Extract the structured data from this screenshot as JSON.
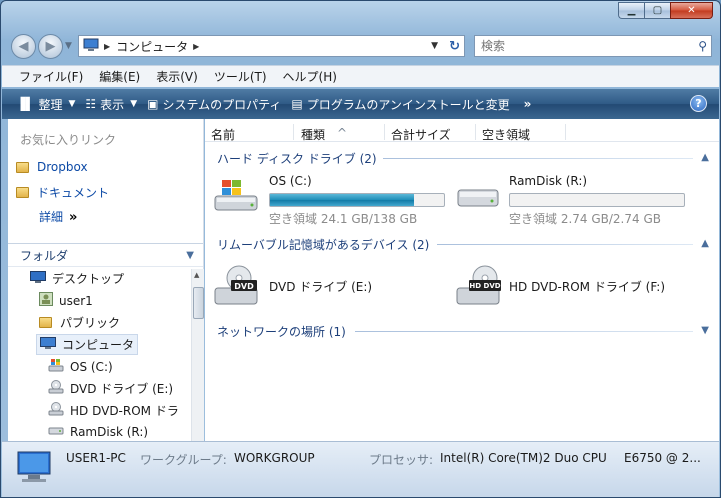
{
  "address": {
    "location": "コンピュータ"
  },
  "search": {
    "placeholder": "検索"
  },
  "menu": [
    "ファイル(F)",
    "編集(E)",
    "表示(V)",
    "ツール(T)",
    "ヘルプ(H)"
  ],
  "command_bar": {
    "organize": "整理",
    "view": "表示",
    "system_properties": "システムのプロパティ",
    "uninstall": "プログラムのアンインストールと変更",
    "more": "»"
  },
  "favorites": {
    "title": "お気に入りリンク",
    "links": [
      "Dropbox",
      "ドキュメント"
    ],
    "details": "詳細",
    "details_arrow": "»"
  },
  "folders": {
    "title": "フォルダ",
    "tree": [
      "デスクトップ",
      "user1",
      "パブリック",
      "コンピュータ",
      "OS (C:)",
      "DVD ドライブ (E:)",
      "HD DVD-ROM ドラ",
      "RamDisk (R:)"
    ]
  },
  "columns": [
    "名前",
    "種類",
    "合計サイズ",
    "空き領域"
  ],
  "groups": {
    "hdd": "ハード ディスク ドライブ (2)",
    "removable": "リムーバブル記憶域があるデバイス (2)",
    "network": "ネットワークの場所 (1)"
  },
  "drives": {
    "c": {
      "name": "OS (C:)",
      "free": "空き領域 24.1 GB/138 GB",
      "used_fraction": 0.825
    },
    "r": {
      "name": "RamDisk (R:)",
      "free": "空き領域 2.74 GB/2.74 GB",
      "used_fraction": 0.0
    },
    "e": {
      "name": "DVD ドライブ (E:)",
      "badge": "DVD"
    },
    "f": {
      "name": "HD DVD-ROM ドライブ (F:)",
      "badge": "HD DVD"
    }
  },
  "status": {
    "computer": "USER1-PC",
    "workgroup_label": "ワークグループ:",
    "workgroup": "WORKGROUP",
    "processor_label": "プロセッサ:",
    "processor": "Intel(R) Core(TM)2 Duo CPU",
    "processor_model": "E6750  @ 2..."
  },
  "colors": {
    "bar_fill": "#1e8db8",
    "link": "#0d4aa6",
    "group_header": "#1d3f7a"
  }
}
